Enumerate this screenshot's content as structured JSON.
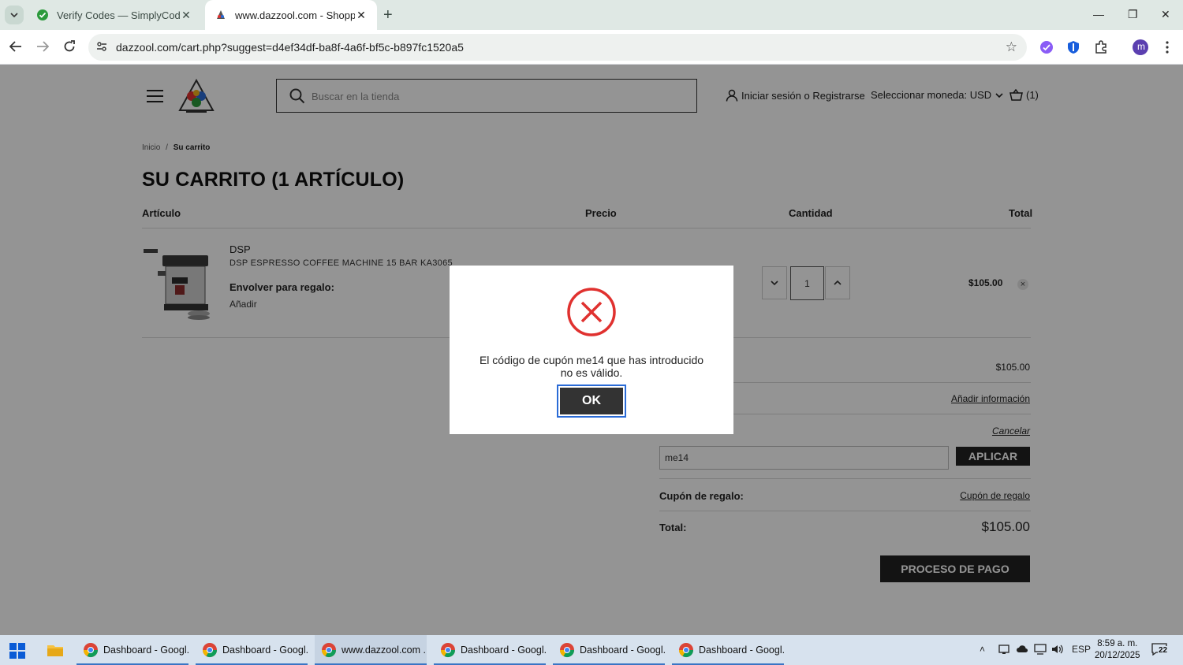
{
  "browser": {
    "tabs": [
      {
        "title": "Verify Codes — SimplyCodes",
        "active": false
      },
      {
        "title": "www.dazzool.com - Shopping Cart",
        "active": true
      }
    ],
    "url": "dazzool.com/cart.php?suggest=d4ef34df-ba8f-4a6f-bf5c-b897fc1520a5",
    "profile_initial": "m"
  },
  "header": {
    "search_placeholder": "Buscar en la tienda",
    "login_label": "Iniciar sesión o Registrarse",
    "currency_label": "Seleccionar moneda: USD",
    "cart_label": "(1)"
  },
  "breadcrumb": {
    "home": "Inicio",
    "separator": "/",
    "current": "Su carrito"
  },
  "page_title": "SU CARRITO (1 ARTÍCULO)",
  "columns": {
    "item": "Artículo",
    "price": "Precio",
    "quantity": "Cantidad",
    "total": "Total"
  },
  "cart_item": {
    "brand": "DSP",
    "name": "DSP ESPRESSO COFFEE MACHINE 15 BAR KA3065",
    "gift_wrap_label": "Envolver para regalo:",
    "gift_wrap_action": "Añadir",
    "quantity": "1",
    "total": "$105.00",
    "remove_symbol": "×"
  },
  "summary": {
    "subtotal": "$105.00",
    "shipping_link": "Añadir información",
    "coupon_cancel": "Cancelar",
    "coupon_value": "me14",
    "apply_label": "APLICAR",
    "gift_coupon_label": "Cupón de regalo:",
    "gift_coupon_link": "Cupón de regalo",
    "total_label": "Total:",
    "total_value": "$105.00",
    "checkout_label": "PROCESO DE PAGO"
  },
  "modal": {
    "message": "El código de cupón me14 que has introducido no es válido.",
    "ok_label": "OK"
  },
  "taskbar": {
    "apps": [
      {
        "label": "Dashboard - Googl...",
        "active": false
      },
      {
        "label": "Dashboard - Googl...",
        "active": false
      },
      {
        "label": "www.dazzool.com ...",
        "active": true
      },
      {
        "label": "Dashboard - Googl...",
        "active": false
      },
      {
        "label": "Dashboard - Googl...",
        "active": false
      },
      {
        "label": "Dashboard - Googl...",
        "active": false
      }
    ],
    "language": "ESP",
    "time": "8:59 a. m.",
    "date": "20/12/2025",
    "notification_count": "22"
  },
  "colors": {
    "accent": "#2a6bd6",
    "error": "#e0312f",
    "dark_button": "#222222"
  }
}
